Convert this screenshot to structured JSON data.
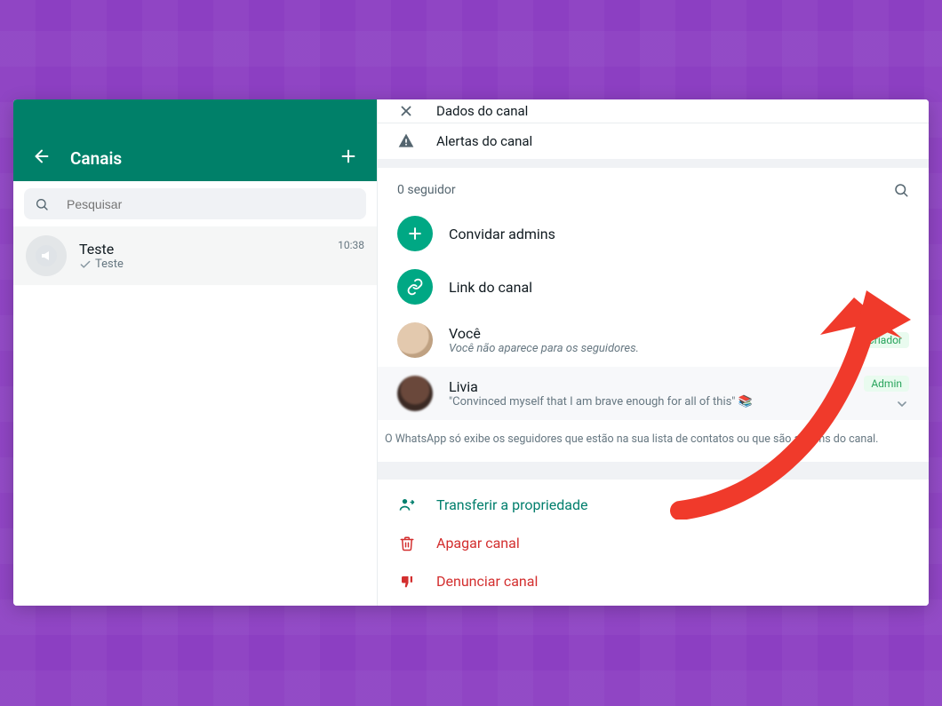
{
  "sidebar": {
    "title": "Canais",
    "search_placeholder": "Pesquisar",
    "channel": {
      "name": "Teste",
      "subtitle": "Teste",
      "time": "10:38"
    }
  },
  "panel": {
    "header_title": "Dados do canal",
    "alerts_label": "Alertas do canal",
    "followers_count": "0 seguidor",
    "invite_admins": "Convidar admins",
    "channel_link": "Link do canal",
    "you": {
      "name": "Você",
      "note": "Você não aparece para os seguidores.",
      "badge": "Criador"
    },
    "member": {
      "name": "Livia",
      "status": "\"Convinced myself that I am brave enough for all of this\" 📚",
      "badge": "Admin"
    },
    "disclaimer": "O WhatsApp só exibe os seguidores que estão na sua lista de contatos ou que são admins do canal.",
    "actions": {
      "transfer": "Transferir a propriedade",
      "delete": "Apagar canal",
      "report": "Denunciar canal"
    }
  },
  "colors": {
    "teal": "#008069",
    "accent": "#00a884",
    "danger": "#d32f2f",
    "bg_purple": "#8c3fc2",
    "arrow": "#f03a2b"
  },
  "icons": {
    "back": "arrow-left-icon",
    "plus": "plus-icon",
    "search": "search-icon",
    "close": "close-icon",
    "warning": "warning-icon",
    "link": "link-icon",
    "transfer": "user-arrow-icon",
    "trash": "trash-icon",
    "thumb_down": "thumb-down-icon",
    "chevron_down": "chevron-down-icon",
    "check": "check-icon"
  }
}
